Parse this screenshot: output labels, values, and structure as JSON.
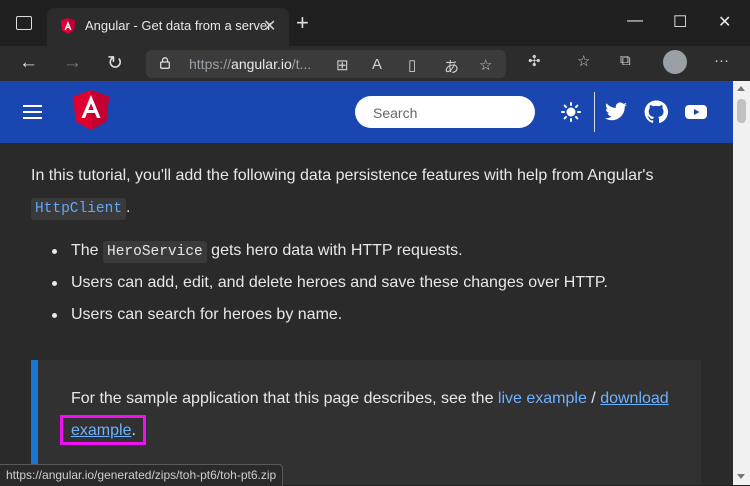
{
  "browser": {
    "tab_title": "Angular - Get data from a server",
    "url_prefix": "https://",
    "url_host": "angular.io",
    "url_rest": "/t...",
    "status_url": "https://angular.io/generated/zips/toh-pt6/toh-pt6.zip"
  },
  "site": {
    "search_placeholder": "Search"
  },
  "article": {
    "intro": "In this tutorial, you'll add the following data persistence features with help from Angular's",
    "intro_code": "HttpClient",
    "intro_end": ".",
    "bullets": [
      {
        "pre": "The ",
        "code": "HeroService",
        "post": " gets hero data with HTTP requests."
      },
      {
        "text": "Users can add, edit, and delete heroes and save these changes over HTTP."
      },
      {
        "text": "Users can search for heroes by name."
      }
    ],
    "note_text": "For the sample application that this page describes, see the ",
    "live_link": "live example",
    "separator": " / ",
    "download_link_1": "download",
    "download_link_2": "example",
    "note_end": "."
  },
  "colors": {
    "brand_blue": "#1946b0",
    "highlight": "#f00ff0",
    "link": "#6eb2ff"
  }
}
